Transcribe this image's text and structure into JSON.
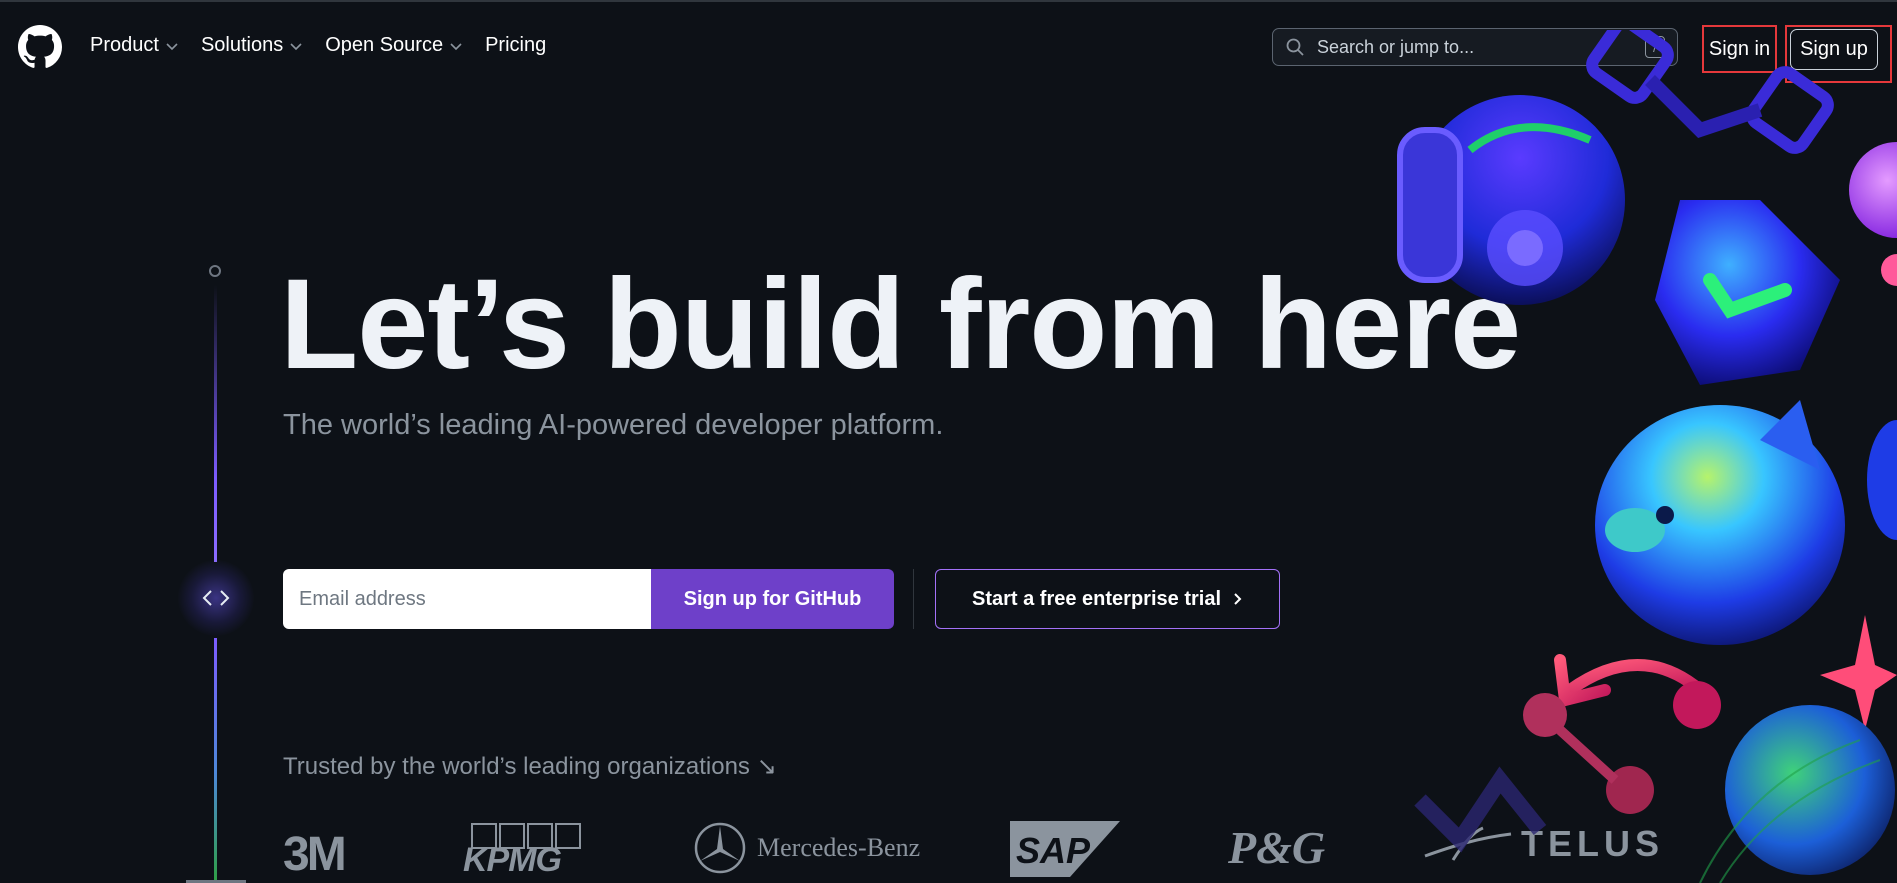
{
  "header": {
    "nav": [
      {
        "label": "Product",
        "has_menu": true
      },
      {
        "label": "Solutions",
        "has_menu": true
      },
      {
        "label": "Open Source",
        "has_menu": true
      },
      {
        "label": "Pricing",
        "has_menu": false
      }
    ],
    "search": {
      "placeholder": "Search or jump to...",
      "shortcut": "/"
    },
    "sign_in": "Sign in",
    "sign_up": "Sign up"
  },
  "hero": {
    "title": "Let’s build from here",
    "subtitle": "The world’s leading AI-powered developer platform.",
    "email_placeholder": "Email address",
    "signup_button": "Sign up for GitHub",
    "trial_button": "Start a free enterprise trial",
    "trial_icon": "chevron-right-icon",
    "rail_icon": "code-icon"
  },
  "trusted": {
    "label": "Trusted by the world’s leading organizations ↘",
    "logos": [
      "3M",
      "KPMG",
      "Mercedes-Benz",
      "SAP",
      "P&G",
      "TELUS"
    ]
  },
  "colors": {
    "background": "#0d1117",
    "primary_button": "#6e40c9",
    "trial_border": "#a371f7",
    "highlight_box": "#e5383b"
  }
}
